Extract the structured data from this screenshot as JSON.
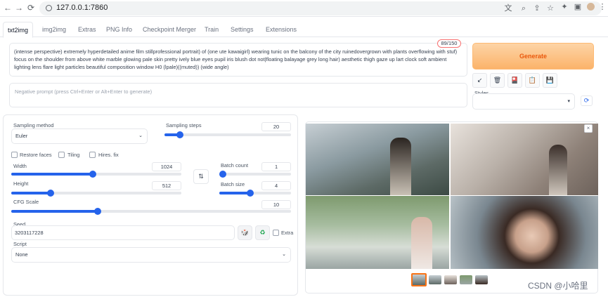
{
  "browser": {
    "url": "127.0.0.1:7860",
    "nav": {
      "back": "←",
      "forward": "→",
      "reload": "⟳"
    },
    "right_icons": [
      "translate-icon",
      "zoom-icon",
      "share-icon",
      "star-icon",
      "extensions-icon",
      "sidebar-icon",
      "profile-icon",
      "menu-icon"
    ]
  },
  "tabs": [
    "txt2img",
    "img2img",
    "Extras",
    "PNG Info",
    "Checkpoint Merger",
    "Train",
    "Settings",
    "Extensions"
  ],
  "active_tab": "txt2img",
  "prompt": {
    "text": "(intense perspective) extremely hyperdetailed anime film stillprofessional portrait) of (one ute kawaigirl) wearing tunic on the balcony of the city ruinedovergrown with plants overflowing with stuf) focus on the shoulder from above white marble glowing pale skin pretty ively blue eyes pupil iris blush dot not|floating balayage grey long hair) aesthetic thigh gaze up lart clock soft ambient lighting lens flare light particles beautiful composition window H0 (lpale)((muted)) (wide angle)",
    "token_count": "89/150"
  },
  "negative_prompt": {
    "placeholder": "Negative prompt (press Ctrl+Enter or Alt+Enter to generate)"
  },
  "generate_label": "Generate",
  "tools": [
    "↙",
    "🗑",
    "🎴",
    "📋",
    "💾"
  ],
  "styles": {
    "label": "Styles",
    "refresh": "⟳"
  },
  "sampling": {
    "method_label": "Sampling method",
    "method": "Euler",
    "steps_label": "Sampling steps",
    "steps": "20",
    "steps_fraction": 0.12
  },
  "options": {
    "restore_faces": "Restore faces",
    "tiling": "Tiling",
    "hires_fix": "Hires. fix"
  },
  "width": {
    "label": "Width",
    "value": "1024",
    "fraction": 0.48
  },
  "height": {
    "label": "Height",
    "value": "512",
    "fraction": 0.23
  },
  "swap_icon": "⇅",
  "batch_count": {
    "label": "Batch count",
    "value": "1",
    "fraction": 0.0
  },
  "batch_size": {
    "label": "Batch size",
    "value": "4",
    "fraction": 0.43
  },
  "cfg_scale": {
    "label": "CFG Scale",
    "value": "10",
    "fraction": 0.31
  },
  "seed": {
    "label": "Seed",
    "value": "3203117228",
    "extra_label": "Extra",
    "dice": "🎲",
    "recycle": "♻"
  },
  "script": {
    "label": "Script",
    "value": "None"
  },
  "gallery": {
    "close": "×"
  },
  "watermark": "CSDN @小哈里",
  "colors": {
    "accent": "#2563eb",
    "generate_text": "#ea580c",
    "counter_border": "#f87171"
  }
}
